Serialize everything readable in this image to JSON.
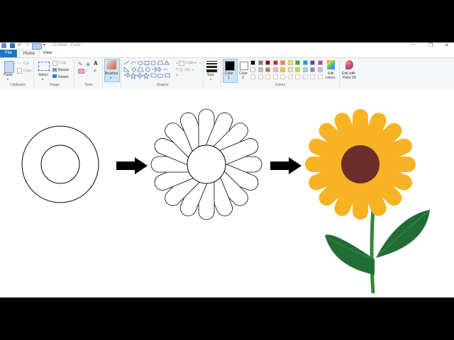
{
  "window": {
    "title": "Untitled - Paint",
    "minimize_glyph": "─",
    "restore_glyph": "❐",
    "close_glyph": "✕"
  },
  "tabs": [
    {
      "label": "File",
      "active": false
    },
    {
      "label": "Home",
      "active": true
    },
    {
      "label": "View",
      "active": false
    }
  ],
  "ribbon": {
    "clipboard": {
      "paste": "Paste",
      "cut": "Cut",
      "copy": "Copy",
      "group": "Clipboard"
    },
    "image": {
      "select": "Select",
      "crop": "Crop",
      "resize": "Resize",
      "rotate": "Rotate",
      "group": "Image"
    },
    "tools": {
      "group": "Tools"
    },
    "brushes": {
      "label": "Brushes"
    },
    "shapes": {
      "outline": "Outline",
      "fill": "Fill",
      "group": "Shapes"
    },
    "size": {
      "label": "Size"
    },
    "color1": {
      "label": "Color",
      "num": "1",
      "color": "#000000"
    },
    "color2": {
      "label": "Color",
      "num": "2",
      "color": "#ffffff"
    },
    "colors": {
      "group": "Colors",
      "edit": "Edit",
      "edit2": "colors"
    },
    "paint3d": {
      "label1": "Edit with",
      "label2": "Paint 3D"
    },
    "palette_row1": [
      "#000000",
      "#7f7f7f",
      "#880015",
      "#ed1c24",
      "#ff7f27",
      "#fff200",
      "#22b14c",
      "#00a2e8",
      "#3f48cc",
      "#a349a4"
    ],
    "palette_row2": [
      "#ffffff",
      "#c3c3c3",
      "#b97a57",
      "#ffaec9",
      "#ffc90e",
      "#efe4b0",
      "#b5e61d",
      "#99d9ea",
      "#7092be",
      "#c8bfe7"
    ]
  },
  "drawing": {
    "petal_color": "#f8b324",
    "center_color": "#6b2e2a",
    "stem_color": "#2f8a3a",
    "leaf_color": "#226d35",
    "arrow_color": "#000000"
  }
}
